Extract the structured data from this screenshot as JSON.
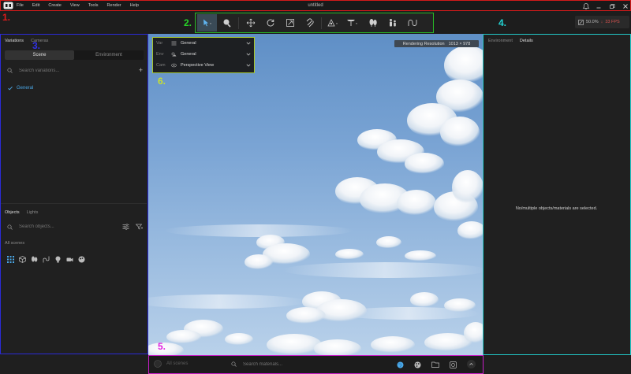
{
  "app": {
    "title": "untitled",
    "menu": [
      "File",
      "Edit",
      "Create",
      "View",
      "Tools",
      "Render",
      "Help"
    ]
  },
  "status": {
    "zoom": "50.0%",
    "fps": "33 FPS",
    "fps_color": "#d9534f"
  },
  "markers": {
    "m1": "1.",
    "m2": "2.",
    "m3": "3.",
    "m4": "4.",
    "m5": "5.",
    "m6": "6."
  },
  "marker_colors": {
    "m1": "#e01b1b",
    "m2": "#27d427",
    "m3": "#3030e6",
    "m4": "#22d6d6",
    "m5": "#e020e0",
    "m6": "#c8e030"
  },
  "toolbar": {
    "tools": [
      "select-tool",
      "paint-tool",
      "move-tool",
      "rotate-tool",
      "scale-tool",
      "magnet-tool",
      "camera-tool",
      "light-tool",
      "trees-tool",
      "people-tool",
      "path-tool"
    ]
  },
  "variations_panel": {
    "tabs": [
      "Variations",
      "Cameras"
    ],
    "segments": [
      "Scene",
      "Environment"
    ],
    "search_placeholder": "Search variations...",
    "items": [
      "General"
    ]
  },
  "objects_panel": {
    "tabs": [
      "Objects",
      "Lights"
    ],
    "search_placeholder": "Search objects...",
    "scope_label": "All scenes"
  },
  "viewport": {
    "rendering_resolution_label": "Rendering Resolution",
    "rendering_resolution_value": "1013 × 978",
    "selectors": [
      {
        "key": "Var",
        "value": "General"
      },
      {
        "key": "Env",
        "value": "General"
      },
      {
        "key": "Cam",
        "value": "Perspective View"
      }
    ]
  },
  "details_panel": {
    "tabs": [
      "Environment",
      "Details"
    ],
    "empty_message": "No/multiple objects/materials are selected."
  },
  "bottom_bar": {
    "scenes_placeholder": "All scenes",
    "materials_placeholder": "Search materials..."
  },
  "colors": {
    "accent": "#4aa8e8"
  }
}
